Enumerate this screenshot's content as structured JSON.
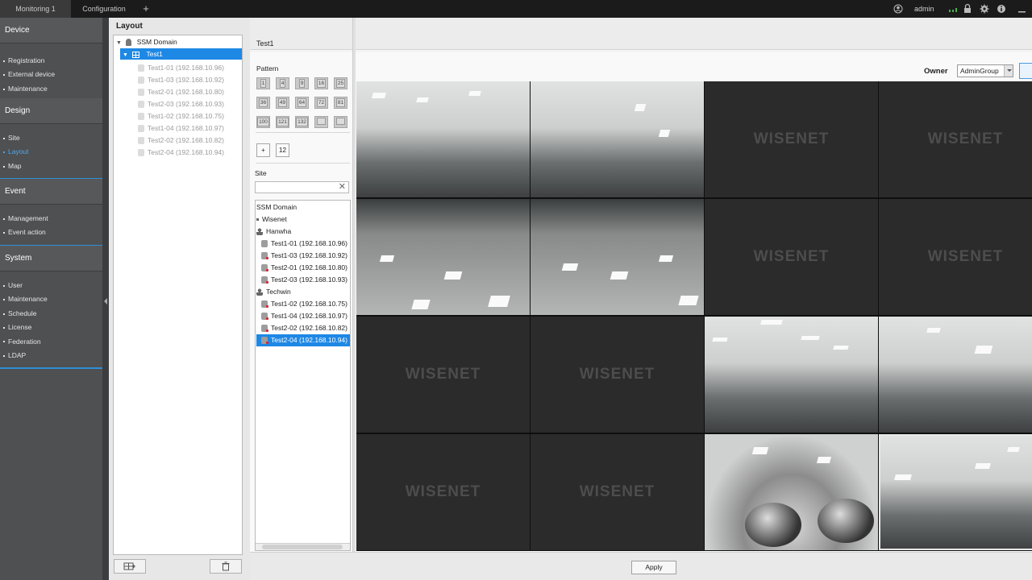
{
  "tabs": [
    {
      "label": "Monitoring 1"
    },
    {
      "label": "Configuration"
    },
    {
      "label": "+"
    }
  ],
  "topbar": {
    "user": "admin"
  },
  "nav": {
    "sections": [
      {
        "title": "Device",
        "items": [
          "Registration",
          "External device",
          "Maintenance"
        ]
      },
      {
        "title": "Design",
        "items": [
          "Site",
          "Layout",
          "Map"
        ]
      },
      {
        "title": "Event",
        "items": [
          "Management",
          "Event action"
        ]
      },
      {
        "title": "System",
        "items": [
          "User",
          "Maintenance",
          "Schedule",
          "License",
          "Federation",
          "LDAP"
        ]
      }
    ],
    "selected": "Layout"
  },
  "layout_panel": {
    "title": "Layout",
    "root": "SSM Domain",
    "layout": "Test1",
    "cameras": [
      "Test1-01 (192.168.10.96)",
      "Test1-03 (192.168.10.92)",
      "Test2-01 (192.168.10.80)",
      "Test2-03 (192.168.10.93)",
      "Test1-02 (192.168.10.75)",
      "Test1-04 (192.168.10.97)",
      "Test2-02 (192.168.10.82)",
      "Test2-04 (192.168.10.94)"
    ]
  },
  "main": {
    "layout_name": "Test1",
    "owner_label": "Owner",
    "owner_value": "AdminGroup",
    "pattern_label": "Pattern",
    "patterns": [
      "1",
      "4",
      "9",
      "16",
      "25",
      "36",
      "49",
      "64",
      "72",
      "81",
      "100",
      "121",
      "132",
      "",
      ""
    ],
    "pattern_add": "+",
    "pattern_count": "12",
    "site_label": "Site",
    "site_search_placeholder": "",
    "site_tree": {
      "root": "SSM Domain",
      "group": "Wisenet",
      "subgroups": [
        {
          "name": "Hanwha",
          "cameras": [
            "Test1-01 (192.168.10.96)",
            "Test1-03 (192.168.10.92)",
            "Test2-01 (192.168.10.80)",
            "Test2-03 (192.168.10.93)"
          ]
        },
        {
          "name": "Techwin",
          "cameras": [
            "Test1-02 (192.168.10.75)",
            "Test1-04 (192.168.10.97)",
            "Test2-02 (192.168.10.82)",
            "Test2-04 (192.168.10.94)"
          ]
        }
      ],
      "selected": "Test2-04 (192.168.10.94)"
    },
    "watermark": "WISENET",
    "apply_label": "Apply"
  },
  "colors": {
    "accent": "#1e88e5",
    "nav_bg": "#4e5052",
    "topbar_bg": "#1b1b1b"
  }
}
